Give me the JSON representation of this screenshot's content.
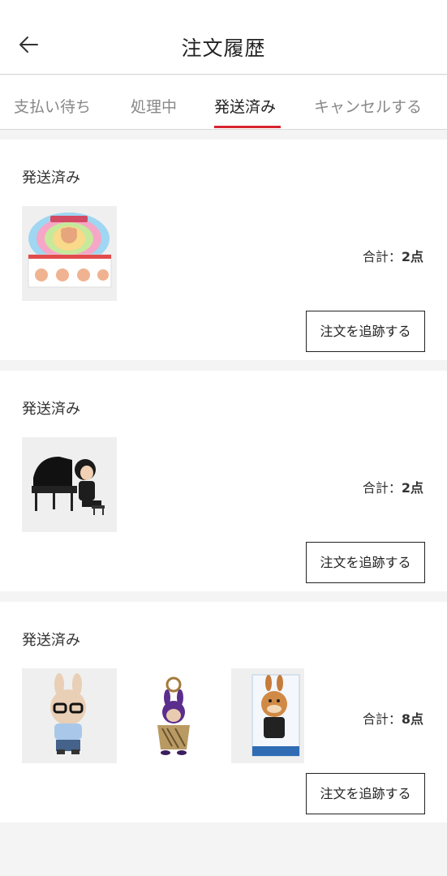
{
  "header": {
    "title": "注文履歴",
    "back_icon": "arrow-left-icon"
  },
  "tabs": [
    {
      "label": "支払い待ち",
      "active": false
    },
    {
      "label": "処理中",
      "active": false
    },
    {
      "label": "発送済み",
      "active": true
    },
    {
      "label": "キャンセルする",
      "active": false
    }
  ],
  "colors": {
    "accent": "#d8252f",
    "background": "#f4f4f4"
  },
  "orders": [
    {
      "status": "発送済み",
      "total_label": "合計：",
      "total_value": "2点",
      "track_label": "注文を追跡する"
    },
    {
      "status": "発送済み",
      "total_label": "合計：",
      "total_value": "2点",
      "track_label": "注文を追跡する"
    },
    {
      "status": "発送済み",
      "total_label": "合計：",
      "total_value": "8点",
      "track_label": "注文を追跡する"
    }
  ]
}
